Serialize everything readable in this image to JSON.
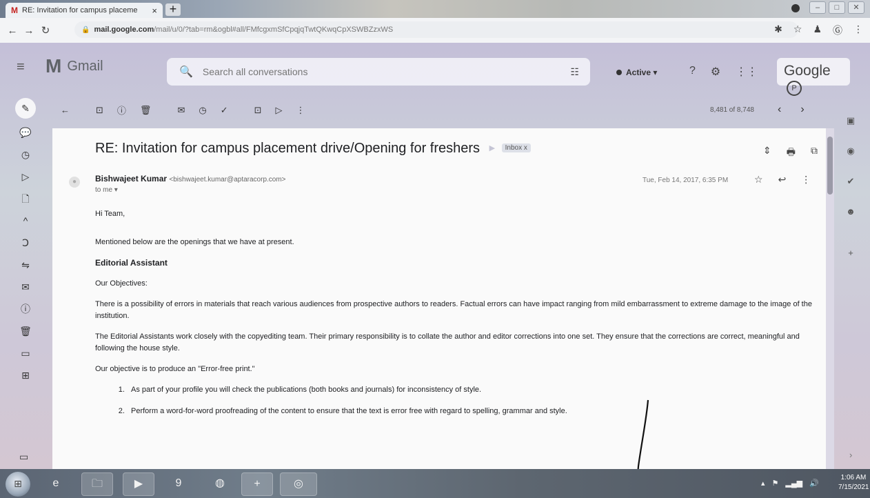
{
  "browser": {
    "tab_title": "RE: Invitation for campus placeme",
    "url_host": "mail.google.com",
    "url_path": "/mail/u/0/?tab=rm&ogbl#all/FMfcgxmSfCpqjqTwtQKwqCpXSWBZzxWS"
  },
  "gmail": {
    "app_name": "Gmail",
    "search_placeholder": "Search all conversations",
    "status": "Active",
    "account_brand": "Google",
    "pager": "8,481 of 8,748"
  },
  "email": {
    "subject": "RE: Invitation for campus placement drive/Opening for freshers",
    "label": "Inbox x",
    "sender_name": "Bishwajeet Kumar",
    "sender_email": "<bishwajeet.kumar@aptaracorp.com>",
    "recipient": "to me",
    "date": "Tue, Feb 14, 2017, 6:35 PM",
    "greeting": "Hi Team,",
    "intro": "Mentioned below are the openings that we have at present.",
    "role_title": "Editorial Assistant",
    "objectives_heading": "Our Objectives:",
    "para1": "There is a possibility of errors in materials that reach various audiences from prospective authors to readers. Factual errors can have impact ranging from mild embarrassment to extreme damage to the image of the institution.",
    "para2": "The Editorial Assistants work closely with the copyediting team. Their primary responsibility is to collate the author and editor corrections into one set. They ensure that the corrections are correct, meaningful and following the house style.",
    "para3": "Our objective is to produce an \"Error-free print.\"",
    "list": [
      "As part of your profile you will check the publications (both books and journals) for inconsistency of style.",
      "Perform a word-for-word proofreading of the content to ensure that the text is error free with regard to spelling, grammar and style."
    ]
  },
  "taskbar": {
    "time": "1:06 AM",
    "date": "7/15/2021"
  }
}
